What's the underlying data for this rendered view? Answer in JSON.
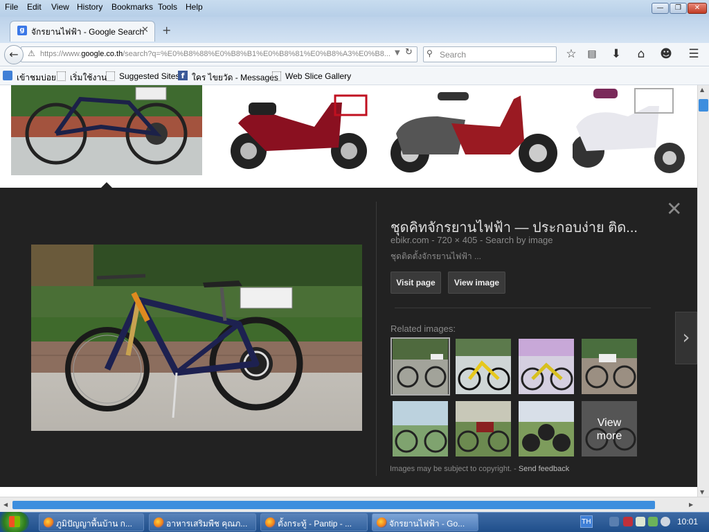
{
  "menu": [
    "File",
    "Edit",
    "View",
    "History",
    "Bookmarks",
    "Tools",
    "Help"
  ],
  "window_controls": {
    "minimize": "—",
    "restore": "❐",
    "close": "✕"
  },
  "tab": {
    "icon": "g",
    "title": "จักรยานไฟฟ้า - Google Search",
    "close": "✕",
    "new_tab": "+"
  },
  "nav": {
    "url_scheme": "https://www.",
    "url_host": "google.co.th",
    "url_path": "/search?q=%E0%B8%88%E0%B8%B1%E0%B8%81%E0%B8%A3%E0%B8...",
    "search_placeholder": "Search"
  },
  "bookmarks": [
    "เข้าชมบ่อย",
    "เริ่มใช้งาน",
    "Suggested Sites",
    "ใคร ไขยวัด - Messages",
    "Web Slice Gallery"
  ],
  "preview": {
    "title": "ชุดคิทจักรยานไฟฟ้า — ประกอบง่าย ติด...",
    "source": "ebikr.com",
    "dimensions": "720 × 405",
    "search_by_image": "Search by image",
    "description": "ชุดติดตั้งจักรยานไฟฟ้า ...",
    "visit_page": "Visit page",
    "view_image": "View image",
    "related_title": "Related images:",
    "view_more_line1": "View",
    "view_more_line2": "more",
    "copyright": "Images may be subject to copyright.",
    "separator": " - ",
    "send_feedback": "Send feedback",
    "close": "✕",
    "next": "›"
  },
  "taskbar": {
    "tasks": [
      "ภูมิปัญญาพื้นบ้าน ก...",
      "อาหารเสริมพืช คุณภ...",
      "ตั้งกระทู้ - Pantip - ...",
      "จักรยานไฟฟ้า - Go..."
    ],
    "active_index": 3,
    "language": "TH",
    "time": "10:01"
  }
}
